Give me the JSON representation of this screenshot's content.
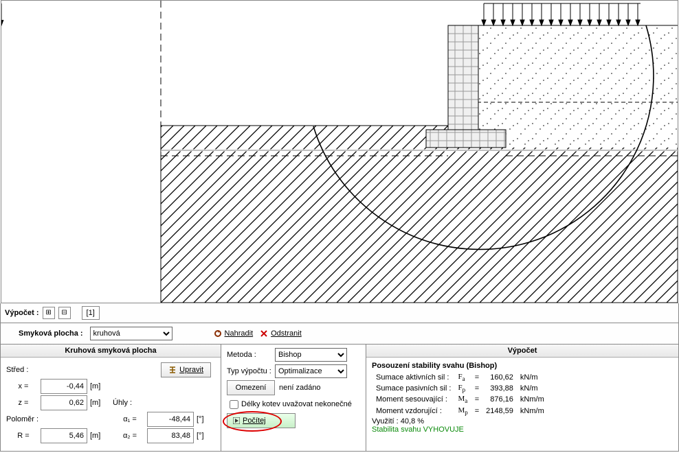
{
  "canvas": {
    "alt": "slope-stability-diagram"
  },
  "toolbar": {
    "label": "Výpočet :",
    "plus": "⊞",
    "minus": "⊟",
    "index": "[1]"
  },
  "toolbar2": {
    "label": "Smyková plocha :",
    "surface_type": "kruhová",
    "replace": "Nahradit",
    "remove": "Odstranit"
  },
  "left": {
    "title": "Kruhová smyková plocha",
    "center_lbl": "Střed :",
    "edit": "Upravit",
    "x_lbl": "x =",
    "x_val": "-0,44",
    "x_unit": "[m]",
    "z_lbl": "z =",
    "z_val": "0,62",
    "z_unit": "[m]",
    "radius_lbl": "Poloměr :",
    "r_lbl": "R =",
    "r_val": "5,46",
    "r_unit": "[m]",
    "angles_lbl": "Úhly :",
    "a1_lbl": "α₁ =",
    "a1_val": "-48,44",
    "a1_unit": "[°]",
    "a2_lbl": "α₂ =",
    "a2_val": "83,48",
    "a2_unit": "[°]"
  },
  "mid": {
    "method_lbl": "Metoda :",
    "method_val": "Bishop",
    "type_lbl": "Typ výpočtu :",
    "type_val": "Optimalizace",
    "constraint_btn": "Omezení",
    "constraint_txt": "není zadáno",
    "anchors_chk": "Délky kotev uvažovat nekonečné",
    "compute": "Počítej"
  },
  "right": {
    "title": "Výpočet",
    "heading": "Posouzení stability svahu (Bishop)",
    "rows": [
      {
        "l": "Sumace aktivních sil :",
        "s": "F",
        "sub": "a",
        "eq": "=",
        "v": "160,62",
        "u": "kN/m"
      },
      {
        "l": "Sumace pasivních sil :",
        "s": "F",
        "sub": "p",
        "eq": "=",
        "v": "393,88",
        "u": "kN/m"
      },
      {
        "l": "Moment sesouvající :",
        "s": "M",
        "sub": "a",
        "eq": "=",
        "v": "876,16",
        "u": "kNm/m"
      },
      {
        "l": "Moment vzdorující :",
        "s": "M",
        "sub": "p",
        "eq": "=",
        "v": "2148,59",
        "u": "kNm/m"
      }
    ],
    "usage": "Využití : 40,8 %",
    "verdict": "Stabilita svahu VYHOVUJE"
  }
}
